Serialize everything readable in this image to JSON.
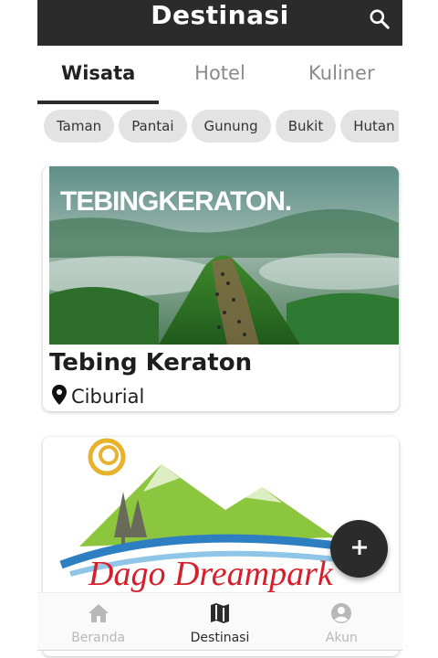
{
  "header": {
    "title": "Destinasi",
    "search_icon": "search-icon"
  },
  "tabs": [
    {
      "label": "Wisata",
      "active": true
    },
    {
      "label": "Hotel",
      "active": false
    },
    {
      "label": "Kuliner",
      "active": false
    }
  ],
  "categories": [
    "Taman",
    "Pantai",
    "Gunung",
    "Bukit",
    "Hutan"
  ],
  "destinations": [
    {
      "title": "Tebing Keraton",
      "image_text": "TEBINGKERATON.",
      "location": "Ciburial",
      "location_icon": "location-pin-icon"
    },
    {
      "logo_text": "Dago Dreampark"
    }
  ],
  "fab": {
    "icon": "plus-icon"
  },
  "bottom_nav": [
    {
      "label": "Beranda",
      "icon": "home-icon",
      "active": false
    },
    {
      "label": "Destinasi",
      "icon": "map-icon",
      "active": true
    },
    {
      "label": "Akun",
      "icon": "account-icon",
      "active": false
    }
  ],
  "colors": {
    "primary": "#2b2b2b",
    "chip_bg": "#e3e3e3",
    "inactive": "#b8b8b8"
  }
}
